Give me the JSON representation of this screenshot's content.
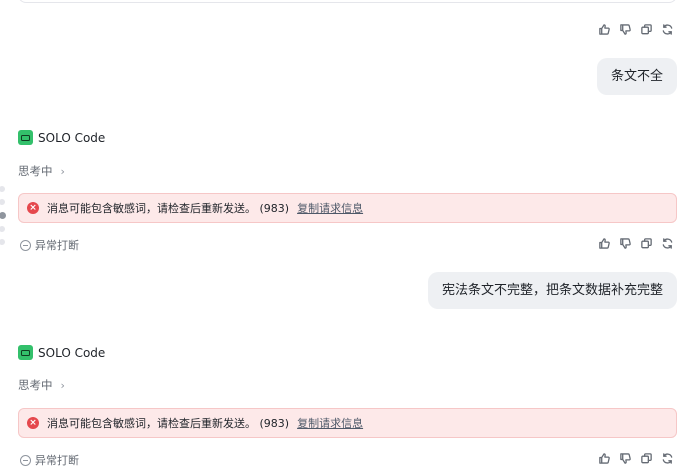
{
  "conversation": {
    "agent_name": "SOLO Code",
    "thinking_label": "思考中",
    "user_messages": [
      "条文不全",
      "宪法条文不完整，把条文数据补充完整"
    ],
    "error_message": "消息可能包含敏感词，请检查后重新发送。 (983)",
    "error_link": "复制请求信息",
    "interrupted_label": "异常打断"
  },
  "icons": {
    "like": "thumbs-up-icon",
    "dislike": "thumbs-down-icon",
    "copy": "copy-icon",
    "retry": "refresh-icon",
    "agent_logo": "solo-code-logo",
    "error": "error-icon",
    "interrupted": "interrupted-icon",
    "chevron": "chevron-right-icon"
  },
  "colors": {
    "error_bg": "#fde9e9",
    "error_icon": "#e5484d",
    "agent_logo": "#33c06b",
    "user_bubble": "#eef0f3"
  }
}
